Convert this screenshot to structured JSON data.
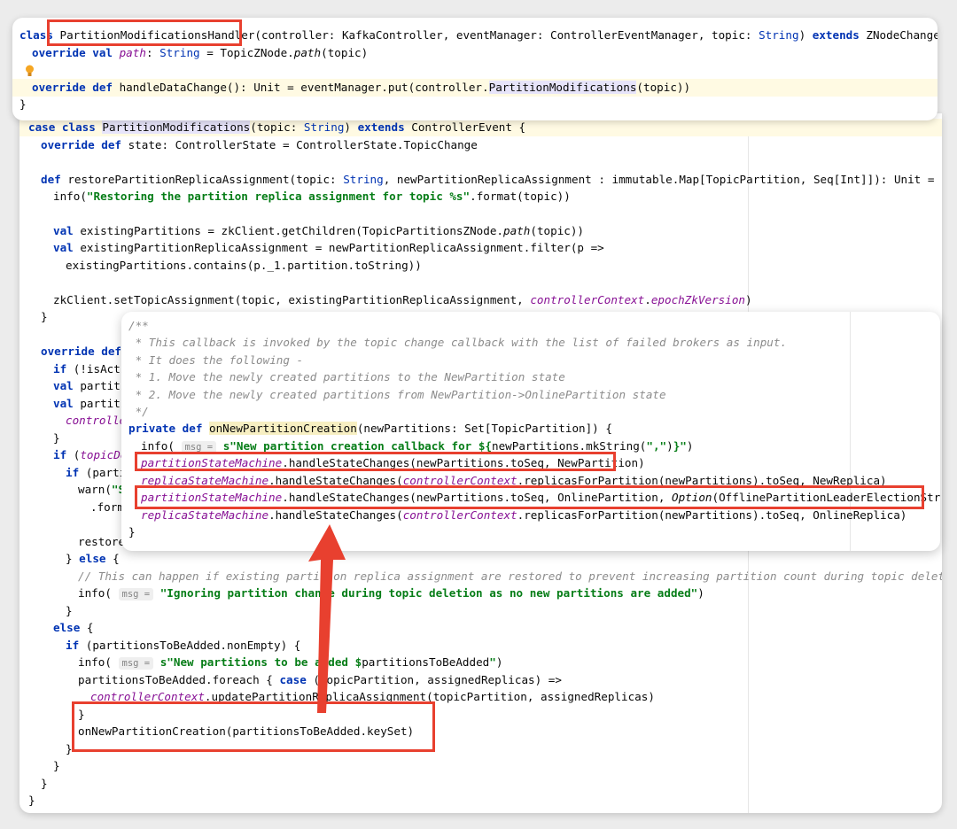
{
  "top": {
    "l1": {
      "c": "class",
      "name": "PartitionModificationsHandler",
      "p1": "(controller: KafkaController, eventManager: ControllerEventManager, topic: ",
      "t": "String",
      "p2": ") ",
      "ext": "extends",
      "p3": " ZNodeChangeHandler {"
    },
    "l2": {
      "k1": "override val",
      "path": "path",
      "p1": ": ",
      "t": "String",
      "p2": " = TopicZNode.",
      "path2": "path",
      "p3": "(topic)"
    },
    "l3": {
      "k": "override def",
      "p1": " handleDataChange(): Unit = eventManager.put(controller.",
      "usage": "PartitionModifications",
      "p2": "(topic))"
    },
    "l4": "}"
  },
  "bg": {
    "l1": {
      "k": "case class",
      "name": "PartitionModifications",
      "p1": "(topic: ",
      "t": "String",
      "p2": ") ",
      "ext": "extends",
      "p3": " ControllerEvent {"
    },
    "l2": {
      "k": "override def",
      "p": " state: ControllerState = ControllerState.TopicChange"
    },
    "l3": {
      "k": "def",
      "p1": " restorePartitionReplicaAssignment(topic: ",
      "t": "String",
      "p2": ", newPartitionReplicaAssignment : immutable.Map[TopicPartition, Seq[Int]]): Unit = {"
    },
    "l4": {
      "p1": "info(",
      "s": "\"Restoring the partition replica assignment for topic %s\"",
      "p2": ".format(topic))"
    },
    "l5": {
      "k": "val",
      "p1": " existingPartitions = zkClient.getChildren(TopicPartitionsZNode.",
      "it": "path",
      "p2": "(topic))"
    },
    "l6": {
      "k": "val",
      "p": " existingPartitionReplicaAssignment = newPartitionReplicaAssignment.filter(p =>"
    },
    "l7": "existingPartitions.contains(p._1.partition.toString))",
    "l8": {
      "p1": "zkClient.setTopicAssignment(topic, existingPartitionReplicaAssignment, ",
      "f1": "controllerContext",
      "p2": ".",
      "f2": "epochZkVersion",
      "p3": ")"
    },
    "l9": "}",
    "l10": {
      "k": "override def"
    },
    "l11": {
      "k": "if",
      "p": " (!isActi"
    },
    "l12": {
      "k": "val",
      "p": " partiti"
    },
    "l13": {
      "k": "val",
      "p": " partiti"
    },
    "l14": {
      "f": "controlle"
    },
    "l15": "}",
    "l16": {
      "k": "if",
      "p": " (",
      "f": "topicDe"
    },
    "l17": {
      "k": "if",
      "p": " (parti"
    },
    "l18": {
      "p": "warn(",
      "s": "\"S"
    },
    "l19": ".form",
    "l20": "restore",
    "l21": {
      "p1": "} ",
      "k": "else",
      "p2": " {"
    },
    "l22": "// This can happen if existing partition replica assignment are restored to prevent increasing partition count during topic deletion",
    "l23": {
      "p1": "info( ",
      "hint": "msg =",
      "s": "\"Ignoring partition change during topic deletion as no new partitions are added\"",
      "p2": ")"
    },
    "l24": "}",
    "l25": {
      "k": "else",
      "p": " {"
    },
    "l26": {
      "k": "if",
      "p": " (partitionsToBeAdded.nonEmpty) {"
    },
    "l27": {
      "p1": "info( ",
      "hint": "msg =",
      "s1": "s\"New partitions to be added ",
      "s2": "$",
      "p2": "partitionsToBeAdded",
      "s3": "\"",
      "p3": ")"
    },
    "l28": {
      "p1": "partitionsToBeAdded.foreach { ",
      "k": "case",
      "p2": " (topicPartition, assignedReplicas) =>"
    },
    "l29": {
      "f": "controllerContext",
      "p": ".updatePartitionReplicaAssignment(topicPartition, assignedReplicas)"
    },
    "l30": "}",
    "l31": "onNewPartitionCreation(partitionsToBeAdded.keySet)",
    "l32": "}",
    "l33": "}",
    "l34": "}",
    "l35": "}"
  },
  "popup": {
    "c1": "/**",
    "c2": " * This callback is invoked by the topic change callback with the list of failed brokers as input.",
    "c3": " * It does the following -",
    "c4": " * 1. Move the newly created partitions to the NewPartition state",
    "c5": " * 2. Move the newly created partitions from NewPartition->OnlinePartition state",
    "c6": " */",
    "l7": {
      "k": "private def",
      "sp": " ",
      "name": "onNewPartitionCreation",
      "p": "(newPartitions: Set[TopicPartition]) {"
    },
    "l8": {
      "p1": "info( ",
      "hint": "msg =",
      "s1": " s\"New partition creation callback for ",
      "s2": "${",
      "p2": "newPartitions.mkString(",
      "s3": "\",\"",
      "p3": ")",
      "s4": "}\"",
      "p4": ")"
    },
    "l9": {
      "f": "partitionStateMachine",
      "p": ".handleStateChanges(newPartitions.toSeq, NewPartition)"
    },
    "l10": {
      "f1": "replicaStateMachine",
      "p1": ".handleStateChanges(",
      "f2": "controllerContext",
      "p2": ".replicasForPartition(newPartitions).toSeq, NewReplica)"
    },
    "l11": {
      "f": "partitionStateMachine",
      "p1": ".handleStateChanges(newPartitions.toSeq, OnlinePartition, ",
      "it": "Option",
      "p2": "(OfflinePartitionLeaderElectionStrategy))"
    },
    "l12": {
      "f1": "replicaStateMachine",
      "p1": ".handleStateChanges(",
      "f2": "controllerContext",
      "p2": ".replicasForPartition(newPartitions).toSeq, OnlineReplica)"
    },
    "l13": "}"
  },
  "colors": {
    "keyword": "#0033b3",
    "string": "#067d17",
    "field": "#871094",
    "comment": "#8c8c8c",
    "annotation": "#e8402f"
  }
}
